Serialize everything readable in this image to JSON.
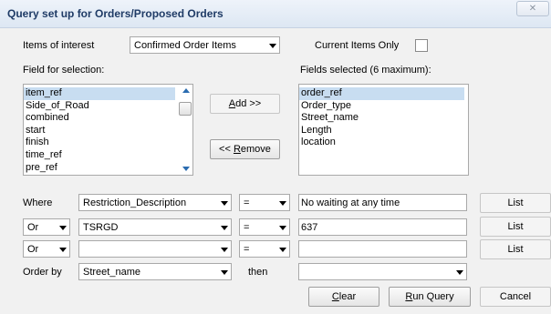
{
  "window": {
    "title": "Query set up for Orders/Proposed Orders"
  },
  "items_of_interest": {
    "label": "Items of interest",
    "value": "Confirmed Order Items"
  },
  "current_items_only": {
    "label": "Current Items Only",
    "checked": false
  },
  "field_for_selection": {
    "label": "Field for selection:",
    "items": [
      "item_ref",
      "Side_of_Road",
      "combined",
      "start",
      "finish",
      "time_ref",
      "pre_ref"
    ],
    "selected_index": 0
  },
  "fields_selected": {
    "label": "Fields selected (6 maximum):",
    "items": [
      "order_ref",
      "Order_type",
      "Street_name",
      "Length",
      "location"
    ],
    "selected_index": 0
  },
  "buttons": {
    "add_underline": "A",
    "add_rest": "dd >>",
    "remove_prefix": "<< ",
    "remove_underline": "R",
    "remove_rest": "emove",
    "clear_underline": "C",
    "clear_rest": "lear",
    "run_underline": "R",
    "run_rest": "un Query",
    "cancel": "Cancel",
    "list": "List"
  },
  "conditions": [
    {
      "connector": "Where",
      "field": "Restriction_Description",
      "operator": "=",
      "value": "No waiting at any time"
    },
    {
      "connector": "Or",
      "field": "TSRGD",
      "operator": "=",
      "value": "637"
    },
    {
      "connector": "Or",
      "field": "",
      "operator": "=",
      "value": ""
    }
  ],
  "order": {
    "label": "Order by",
    "field": "Street_name",
    "then_label": "then",
    "then_field": ""
  },
  "icons": {
    "close": "close-icon",
    "dropdown": "chevron-down-icon"
  }
}
